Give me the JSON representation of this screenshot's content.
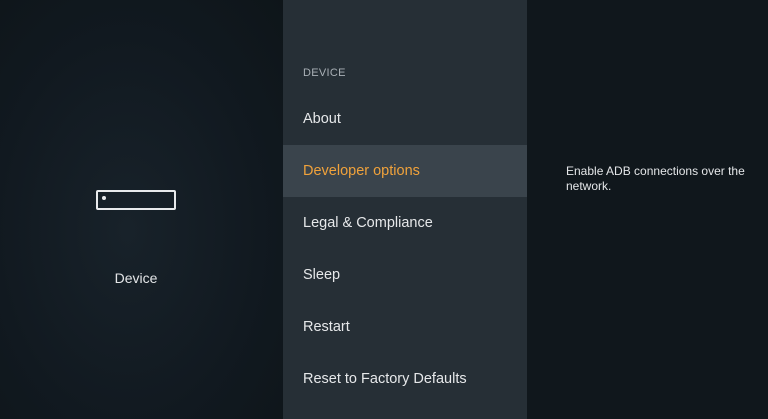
{
  "left_panel": {
    "icon": "fire-tv-device-icon",
    "label": "Device"
  },
  "menu": {
    "section_header": "DEVICE",
    "items": [
      {
        "label": "About",
        "selected": false
      },
      {
        "label": "Developer options",
        "selected": true
      },
      {
        "label": "Legal & Compliance",
        "selected": false
      },
      {
        "label": "Sleep",
        "selected": false
      },
      {
        "label": "Restart",
        "selected": false
      },
      {
        "label": "Reset to Factory Defaults",
        "selected": false
      }
    ]
  },
  "detail": {
    "description": "Enable ADB connections over the network."
  },
  "colors": {
    "accent": "#f0a23b",
    "menu_background": "#262f36",
    "selected_background": "#3a444c"
  }
}
